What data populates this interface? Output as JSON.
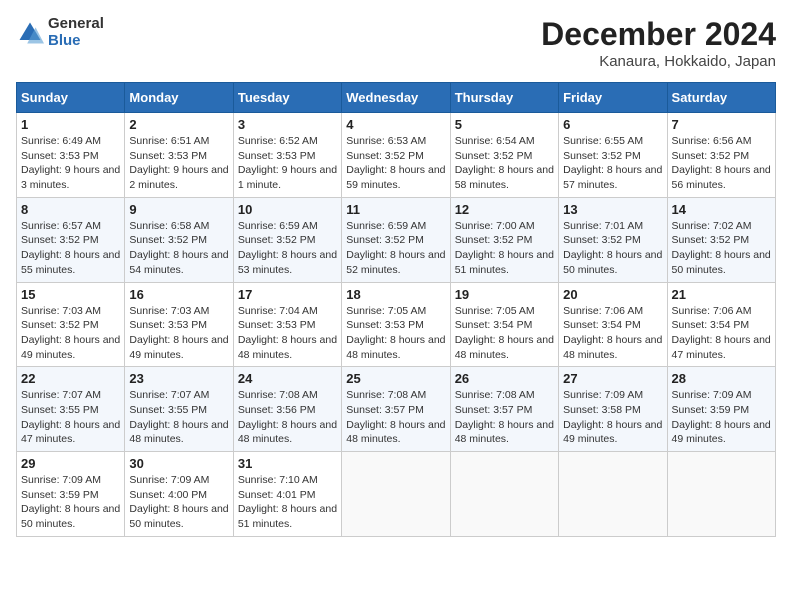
{
  "header": {
    "logo": {
      "general": "General",
      "blue": "Blue"
    },
    "title": "December 2024",
    "subtitle": "Kanaura, Hokkaido, Japan"
  },
  "calendar": {
    "weekdays": [
      "Sunday",
      "Monday",
      "Tuesday",
      "Wednesday",
      "Thursday",
      "Friday",
      "Saturday"
    ],
    "weeks": [
      [
        {
          "day": "1",
          "sunrise": "6:49 AM",
          "sunset": "3:53 PM",
          "daylight": "9 hours and 3 minutes."
        },
        {
          "day": "2",
          "sunrise": "6:51 AM",
          "sunset": "3:53 PM",
          "daylight": "9 hours and 2 minutes."
        },
        {
          "day": "3",
          "sunrise": "6:52 AM",
          "sunset": "3:53 PM",
          "daylight": "9 hours and 1 minute."
        },
        {
          "day": "4",
          "sunrise": "6:53 AM",
          "sunset": "3:52 PM",
          "daylight": "8 hours and 59 minutes."
        },
        {
          "day": "5",
          "sunrise": "6:54 AM",
          "sunset": "3:52 PM",
          "daylight": "8 hours and 58 minutes."
        },
        {
          "day": "6",
          "sunrise": "6:55 AM",
          "sunset": "3:52 PM",
          "daylight": "8 hours and 57 minutes."
        },
        {
          "day": "7",
          "sunrise": "6:56 AM",
          "sunset": "3:52 PM",
          "daylight": "8 hours and 56 minutes."
        }
      ],
      [
        {
          "day": "8",
          "sunrise": "6:57 AM",
          "sunset": "3:52 PM",
          "daylight": "8 hours and 55 minutes."
        },
        {
          "day": "9",
          "sunrise": "6:58 AM",
          "sunset": "3:52 PM",
          "daylight": "8 hours and 54 minutes."
        },
        {
          "day": "10",
          "sunrise": "6:59 AM",
          "sunset": "3:52 PM",
          "daylight": "8 hours and 53 minutes."
        },
        {
          "day": "11",
          "sunrise": "6:59 AM",
          "sunset": "3:52 PM",
          "daylight": "8 hours and 52 minutes."
        },
        {
          "day": "12",
          "sunrise": "7:00 AM",
          "sunset": "3:52 PM",
          "daylight": "8 hours and 51 minutes."
        },
        {
          "day": "13",
          "sunrise": "7:01 AM",
          "sunset": "3:52 PM",
          "daylight": "8 hours and 50 minutes."
        },
        {
          "day": "14",
          "sunrise": "7:02 AM",
          "sunset": "3:52 PM",
          "daylight": "8 hours and 50 minutes."
        }
      ],
      [
        {
          "day": "15",
          "sunrise": "7:03 AM",
          "sunset": "3:52 PM",
          "daylight": "8 hours and 49 minutes."
        },
        {
          "day": "16",
          "sunrise": "7:03 AM",
          "sunset": "3:53 PM",
          "daylight": "8 hours and 49 minutes."
        },
        {
          "day": "17",
          "sunrise": "7:04 AM",
          "sunset": "3:53 PM",
          "daylight": "8 hours and 48 minutes."
        },
        {
          "day": "18",
          "sunrise": "7:05 AM",
          "sunset": "3:53 PM",
          "daylight": "8 hours and 48 minutes."
        },
        {
          "day": "19",
          "sunrise": "7:05 AM",
          "sunset": "3:54 PM",
          "daylight": "8 hours and 48 minutes."
        },
        {
          "day": "20",
          "sunrise": "7:06 AM",
          "sunset": "3:54 PM",
          "daylight": "8 hours and 48 minutes."
        },
        {
          "day": "21",
          "sunrise": "7:06 AM",
          "sunset": "3:54 PM",
          "daylight": "8 hours and 47 minutes."
        }
      ],
      [
        {
          "day": "22",
          "sunrise": "7:07 AM",
          "sunset": "3:55 PM",
          "daylight": "8 hours and 47 minutes."
        },
        {
          "day": "23",
          "sunrise": "7:07 AM",
          "sunset": "3:55 PM",
          "daylight": "8 hours and 48 minutes."
        },
        {
          "day": "24",
          "sunrise": "7:08 AM",
          "sunset": "3:56 PM",
          "daylight": "8 hours and 48 minutes."
        },
        {
          "day": "25",
          "sunrise": "7:08 AM",
          "sunset": "3:57 PM",
          "daylight": "8 hours and 48 minutes."
        },
        {
          "day": "26",
          "sunrise": "7:08 AM",
          "sunset": "3:57 PM",
          "daylight": "8 hours and 48 minutes."
        },
        {
          "day": "27",
          "sunrise": "7:09 AM",
          "sunset": "3:58 PM",
          "daylight": "8 hours and 49 minutes."
        },
        {
          "day": "28",
          "sunrise": "7:09 AM",
          "sunset": "3:59 PM",
          "daylight": "8 hours and 49 minutes."
        }
      ],
      [
        {
          "day": "29",
          "sunrise": "7:09 AM",
          "sunset": "3:59 PM",
          "daylight": "8 hours and 50 minutes."
        },
        {
          "day": "30",
          "sunrise": "7:09 AM",
          "sunset": "4:00 PM",
          "daylight": "8 hours and 50 minutes."
        },
        {
          "day": "31",
          "sunrise": "7:10 AM",
          "sunset": "4:01 PM",
          "daylight": "8 hours and 51 minutes."
        },
        null,
        null,
        null,
        null
      ]
    ]
  }
}
